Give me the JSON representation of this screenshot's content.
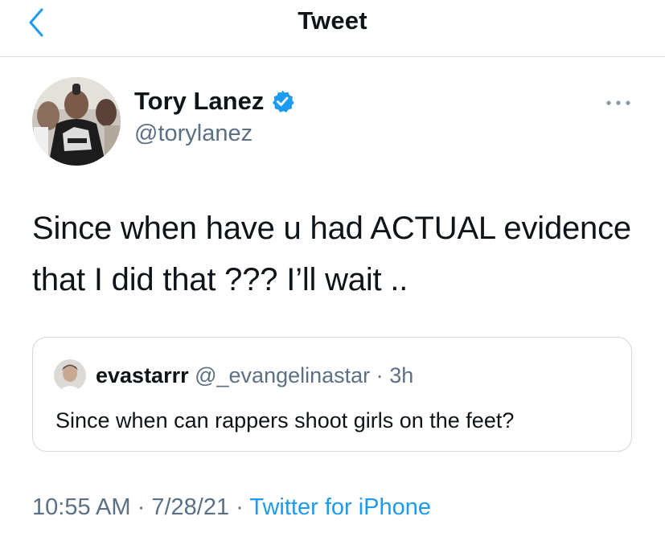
{
  "header": {
    "title": "Tweet",
    "back_icon": "chevron-left-icon",
    "accent_color": "#1d9bf0"
  },
  "author": {
    "display_name": "Tory Lanez",
    "handle": "@torylanez",
    "verified_icon": "verified-badge-icon"
  },
  "tweet": {
    "text": "Since when have u had ACTUAL evidence that I did that ??? I’ll wait .."
  },
  "quoted_tweet": {
    "display_name": "evastarrr",
    "handle": "@_evangelinastar",
    "separator": "·",
    "time": "3h",
    "text": "Since when can rappers shoot girls on the feet?"
  },
  "footer": {
    "time": "10:55 AM",
    "separator1": "·",
    "date": "7/28/21",
    "separator2": "·",
    "source": "Twitter for iPhone"
  },
  "colors": {
    "text_primary": "#0f1419",
    "text_secondary": "#5b7083",
    "link": "#1d9bf0",
    "border": "#cfd9de"
  }
}
